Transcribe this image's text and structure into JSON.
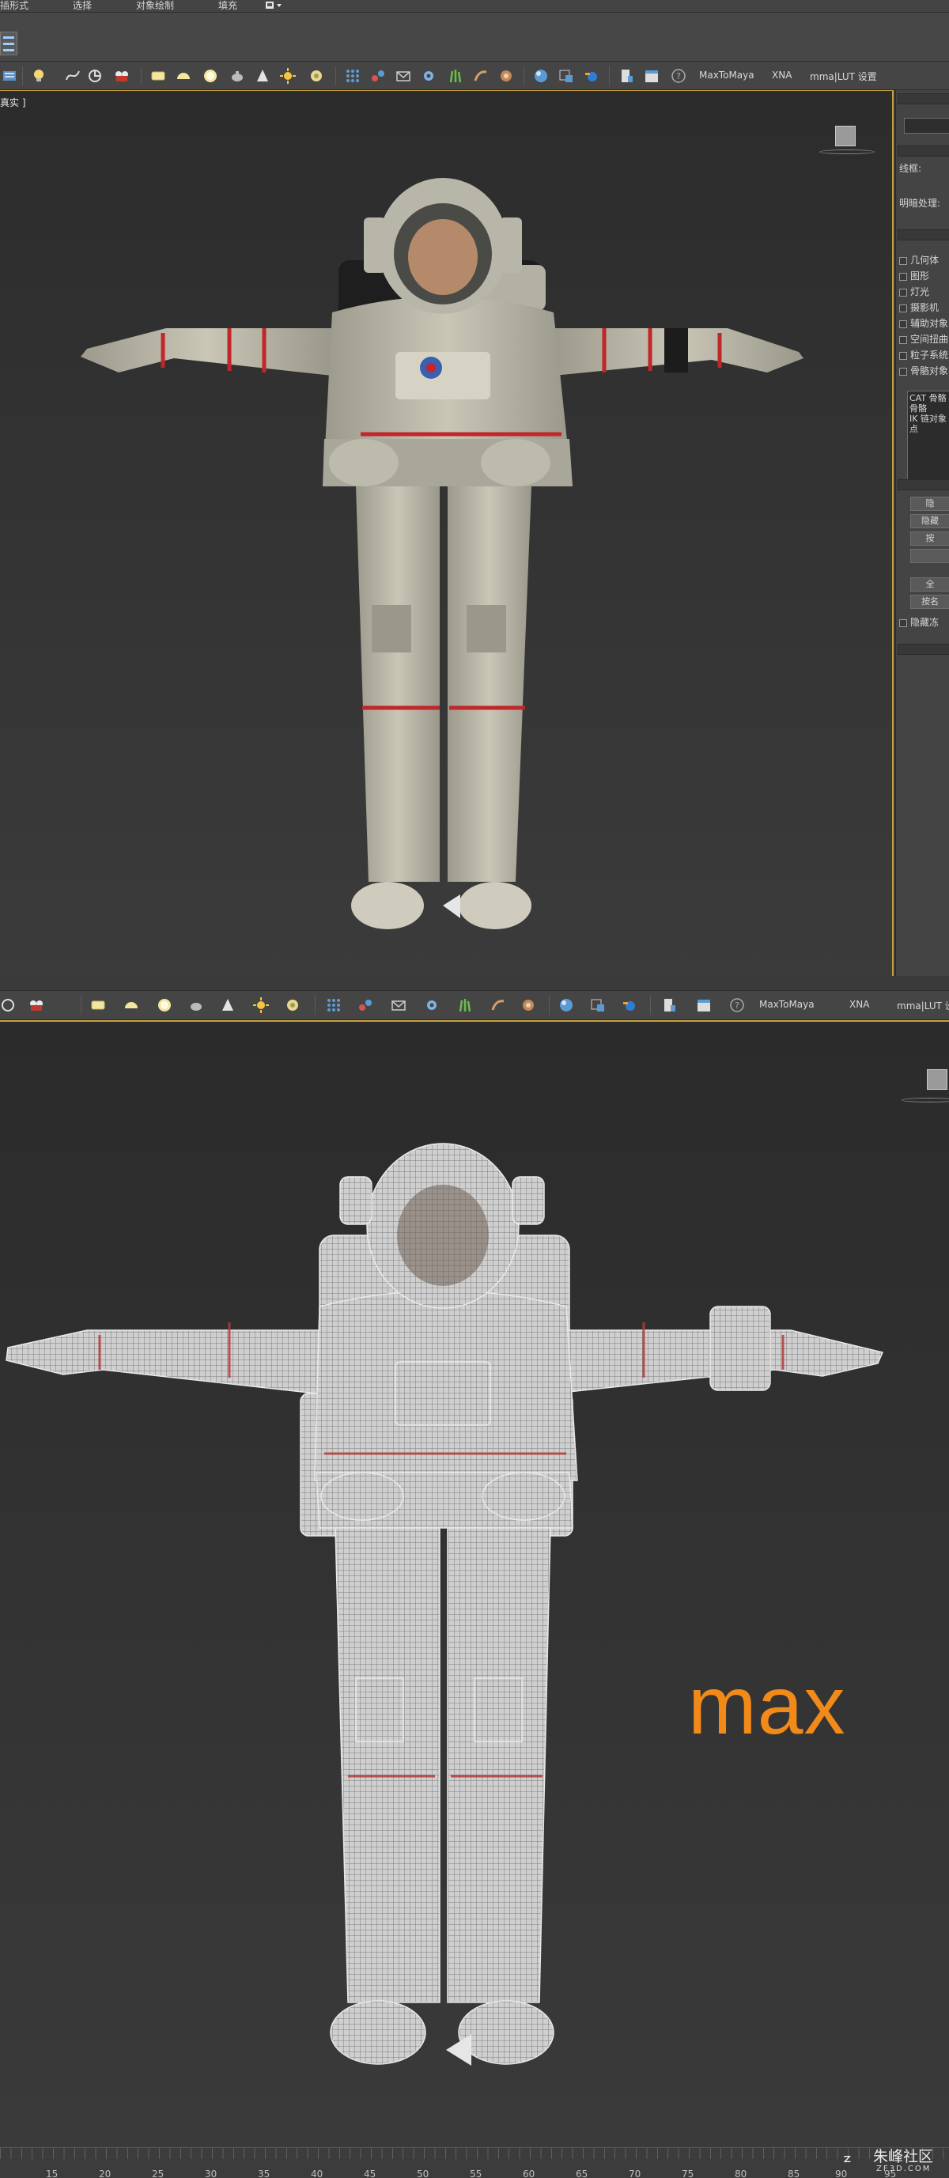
{
  "menu": {
    "items": [
      "插形式",
      "选择",
      "对象绘制",
      "填充"
    ]
  },
  "toolbar_top": {
    "labels": [
      "MaxToMaya",
      "XNA",
      "mma|LUT 设置"
    ]
  },
  "toolbar_bottom": {
    "labels": [
      "MaxToMaya",
      "XNA",
      "mma|LUT 设置"
    ]
  },
  "viewport_top": {
    "label": "真实 ]"
  },
  "command_panel": {
    "fields": [
      "线框:",
      "明暗处理:"
    ],
    "display_items": [
      "几何体",
      "图形",
      "灯光",
      "摄影机",
      "辅助对象",
      "空间扭曲",
      "粒子系统",
      "骨骼对象"
    ],
    "list_lines": [
      "CAT 骨骼",
      "骨骼",
      "IK 链对象",
      "点"
    ],
    "buttons": [
      "隐",
      "隐藏",
      "按",
      "",
      "",
      "全",
      "按名"
    ],
    "bottom_check": "隐藏冻"
  },
  "overlay": {
    "max_label": "max"
  },
  "timeline": {
    "ticks": [
      "15",
      "20",
      "25",
      "30",
      "35",
      "40",
      "45",
      "50",
      "55",
      "60",
      "65",
      "70",
      "75",
      "80",
      "85",
      "90",
      "95"
    ]
  },
  "watermark": {
    "text": "朱峰社区",
    "sub": "ZF3D.COM"
  },
  "colors": {
    "accent_orange": "#f28a1a",
    "viewport_border": "#c8a23c",
    "suit_stripe": "#c0262a"
  }
}
